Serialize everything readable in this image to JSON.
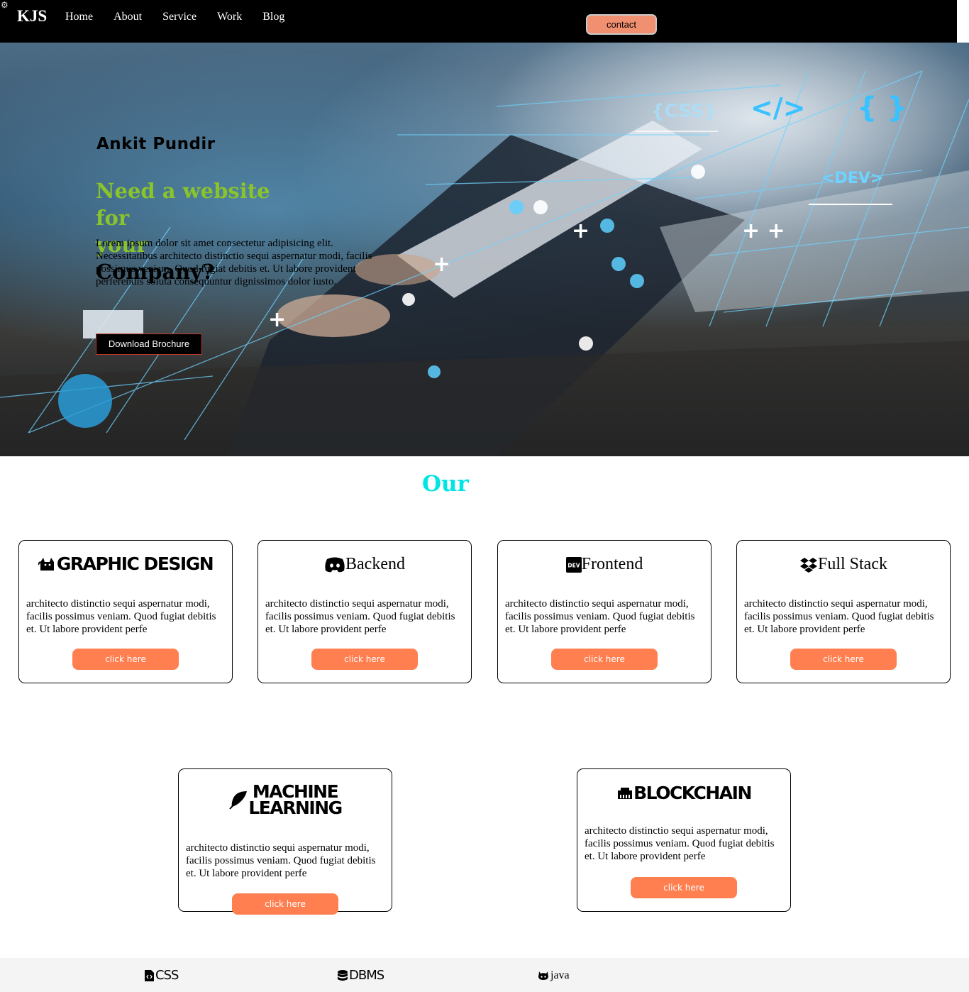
{
  "nav": {
    "logo": "KJS",
    "items": [
      "Home",
      "About",
      "Service",
      "Work",
      "Blog"
    ],
    "contact_label": "contact"
  },
  "hero": {
    "name": "Ankit Pundir",
    "headline_green_1": "Need a website for",
    "headline_green_2": "your",
    "headline_dark": "Company?",
    "body": "Lorem ipsum dolor sit amet consectetur adipisicing elit. Necessitatibus architecto distinctio sequi aspernatur modi, facilis possimus veniam. Quod fugiat debitis et. Ut labore provident perferendis soluta consequuntur dignissimos dolor iusto.",
    "brochure_label": "Download Brochure"
  },
  "services": {
    "title": "Our",
    "cards": [
      {
        "title": "GRAPHIC DESIGN",
        "icon": "cat-icon",
        "text": "architecto distinctio sequi aspernatur modi, facilis possimus veniam. Quod fugiat debitis et. Ut labore provident perfe",
        "button": "click here"
      },
      {
        "title": "Backend",
        "icon": "discord-icon",
        "text": "architecto distinctio sequi aspernatur modi, facilis possimus veniam. Quod fugiat debitis et. Ut labore provident perfe",
        "button": "click here"
      },
      {
        "title": "Frontend",
        "icon": "dev-icon",
        "text": "architecto distinctio sequi aspernatur modi, facilis possimus veniam. Quod fugiat debitis et. Ut labore provident perfe",
        "button": "click here"
      },
      {
        "title": "Full Stack",
        "icon": "dropbox-icon",
        "text": "architecto distinctio sequi aspernatur modi, facilis possimus veniam. Quod fugiat debitis et. Ut labore provident perfe",
        "button": "click here"
      },
      {
        "title_line1": "MACHINE",
        "title_line2": "LEARNING",
        "icon": "feather-icon",
        "text": "architecto distinctio sequi aspernatur modi, facilis possimus veniam. Quod fugiat debitis et. Ut labore provident perfe",
        "button": "click here"
      },
      {
        "title": "BLOCKCHAIN",
        "icon": "ethernet-icon",
        "text": "architecto distinctio sequi aspernatur modi, facilis possimus veniam. Quod fugiat debitis et. Ut labore provident perfe",
        "button": "click here"
      }
    ]
  },
  "footer": {
    "items": [
      {
        "label": "CSS",
        "icon": "file-code-icon"
      },
      {
        "label": "DBMS",
        "icon": "database-icon"
      },
      {
        "label": "java",
        "icon": "github-icon"
      }
    ]
  },
  "colors": {
    "nav_bg": "#000000",
    "contact_btn": "#f19070",
    "headline_green": "#8ac42a",
    "section_title": "#00e5e5",
    "card_button": "#ff7f50",
    "footer_bg": "#f4f4f4"
  }
}
